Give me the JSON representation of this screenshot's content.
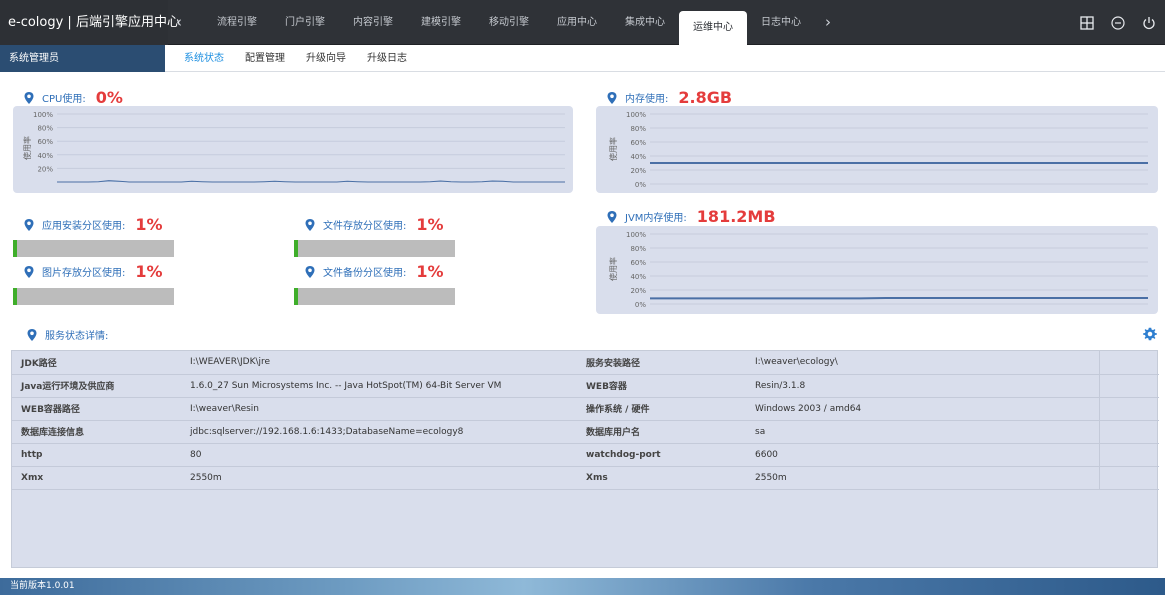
{
  "app": {
    "title": "e-cology | 后端引擎应用中心"
  },
  "nav": {
    "tabs": [
      {
        "label": "流程引擎"
      },
      {
        "label": "门户引擎"
      },
      {
        "label": "内容引擎"
      },
      {
        "label": "建模引擎"
      },
      {
        "label": "移动引擎"
      },
      {
        "label": "应用中心"
      },
      {
        "label": "集成中心"
      },
      {
        "label": "运维中心"
      },
      {
        "label": "日志中心"
      }
    ],
    "active_tab": "运维中心",
    "prev_icon": "chevron-left-icon",
    "next_icon": "chevron-right-icon",
    "right_icons": [
      "grid-icon",
      "menu-circle-icon",
      "power-icon"
    ]
  },
  "subnav": {
    "admin_label": "系统管理员",
    "tabs": [
      {
        "label": "系统状态"
      },
      {
        "label": "配置管理"
      },
      {
        "label": "升级向导"
      },
      {
        "label": "升级日志"
      }
    ],
    "active_tab": "系统状态"
  },
  "metrics": {
    "cpu": {
      "label": "CPU使用:",
      "value": "0%"
    },
    "memory": {
      "label": "内存使用:",
      "value": "2.8GB"
    },
    "jvm": {
      "label": "JVM内存使用:",
      "value": "181.2MB"
    },
    "app_partition": {
      "label": "应用安装分区使用:",
      "value": "1%",
      "fraction": 0.01
    },
    "file_partition": {
      "label": "文件存放分区使用:",
      "value": "1%",
      "fraction": 0.01
    },
    "image_partition": {
      "label": "图片存放分区使用:",
      "value": "1%",
      "fraction": 0.01
    },
    "backup_partition": {
      "label": "文件备份分区使用:",
      "value": "1%",
      "fraction": 0.01
    }
  },
  "chart_data": [
    {
      "type": "area",
      "title": "CPU使用: 0%",
      "ylabel": "使用率",
      "ylim": [
        0,
        100
      ],
      "y_ticks": [
        "100%",
        "80%",
        "60%",
        "40%",
        "20%"
      ],
      "values": [
        0,
        0,
        0,
        0,
        0.5,
        2,
        1,
        0,
        0,
        0,
        0,
        0,
        0,
        1,
        0.5,
        0,
        0,
        0,
        0,
        0,
        0.5,
        1,
        0.5,
        0,
        0,
        0,
        0,
        0,
        1,
        0.5,
        0,
        0,
        0,
        0,
        0,
        0,
        0.5,
        1.5,
        0.5,
        0,
        0,
        0.5,
        1.5,
        1,
        0,
        0,
        0,
        0,
        0,
        0
      ]
    },
    {
      "type": "line",
      "title": "内存使用: 2.8GB",
      "ylabel": "使用率",
      "ylim": [
        0,
        100
      ],
      "y_ticks": [
        "100%",
        "80%",
        "60%",
        "40%",
        "20%",
        "0%"
      ],
      "values": [
        30,
        30,
        30,
        30,
        30,
        30,
        30,
        30,
        30,
        30,
        30,
        30,
        30,
        30,
        30,
        30,
        30,
        30,
        30,
        30
      ]
    },
    {
      "type": "line",
      "title": "JVM内存使用: 181.2MB",
      "ylabel": "使用率",
      "ylim": [
        0,
        100
      ],
      "y_ticks": [
        "100%",
        "80%",
        "60%",
        "40%",
        "20%",
        "0%"
      ],
      "values": [
        8,
        8,
        8,
        8,
        8,
        8,
        8,
        8,
        8,
        8.5,
        8.5,
        8.5,
        8.5,
        8.5,
        8.5,
        8.5,
        8.5,
        8.5,
        8.5,
        8.5
      ]
    }
  ],
  "services": {
    "title": "服务状态详情:",
    "settings_icon": "gear-icon",
    "rows": [
      {
        "k1": "JDK路径",
        "v1": "I:\\WEAVER\\JDK\\jre",
        "k2": "服务安装路径",
        "v2": "I:\\weaver\\ecology\\"
      },
      {
        "k1": "Java运行环境及供应商",
        "v1": "1.6.0_27 Sun Microsystems Inc. -- Java HotSpot(TM) 64-Bit Server VM",
        "k2": "WEB容器",
        "v2": "Resin/3.1.8"
      },
      {
        "k1": "WEB容器路径",
        "v1": "I:\\weaver\\Resin",
        "k2": "操作系统 / 硬件",
        "v2": "Windows 2003 / amd64"
      },
      {
        "k1": "数据库连接信息",
        "v1": "jdbc:sqlserver://192.168.1.6:1433;DatabaseName=ecology8",
        "k2": "数据库用户名",
        "v2": "sa"
      },
      {
        "k1": "http",
        "v1": "80",
        "k2": "watchdog-port",
        "v2": "6600"
      },
      {
        "k1": "Xmx",
        "v1": "2550m",
        "k2": "Xms",
        "v2": "2550m"
      }
    ]
  },
  "footer": {
    "version": "当前版本1.0.01"
  },
  "colors": {
    "topbar": "#2f3237",
    "admin_bg": "#2b4d72",
    "accent_blue": "#1e8fe0",
    "value_red": "#e43c3c",
    "chart_bg": "#d9deec",
    "line_blue": "#4a6fa5",
    "bar_green": "#3fae2a",
    "bar_gray": "#bcbcbc"
  }
}
